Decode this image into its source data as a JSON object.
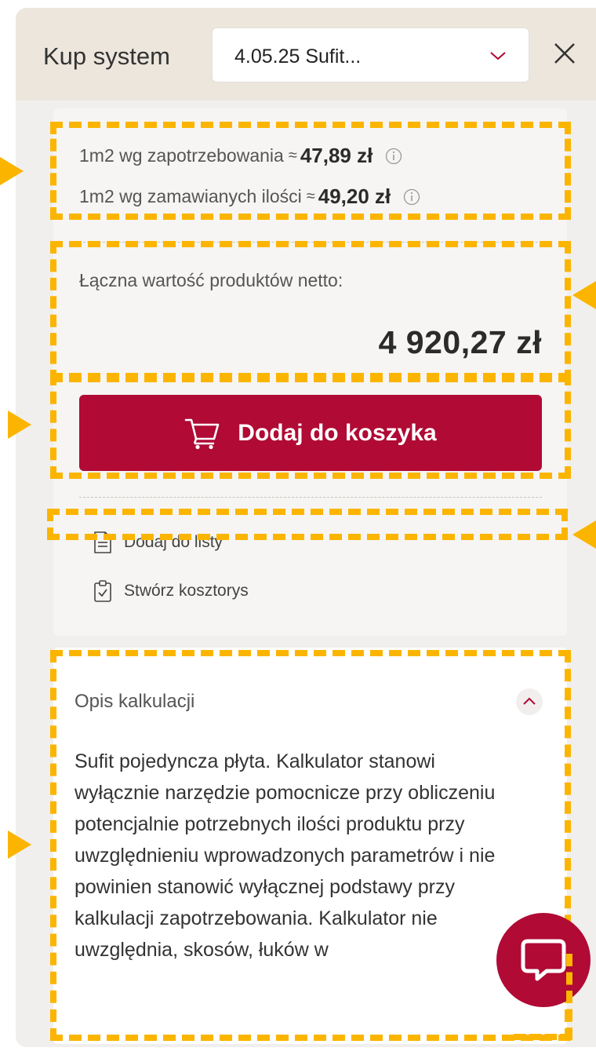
{
  "header": {
    "title": "Kup system",
    "select_value": "4.05.25 Sufit...",
    "close_icon": "close-icon",
    "chevron_icon": "chevron-down-icon"
  },
  "pricing": {
    "per_m2_need_label": "1m2 wg zapotrzebowania",
    "per_m2_need_approx": "≈",
    "per_m2_need_value": "47,89 zł",
    "per_m2_order_label": "1m2 wg zamawianych ilości",
    "per_m2_order_approx": "≈",
    "per_m2_order_value": "49,20 zł",
    "info_icon": "info-icon"
  },
  "total": {
    "label": "Łączna wartość produktów netto:",
    "value": "4 920,27 zł"
  },
  "actions": {
    "add_to_cart": "Dodaj do koszyka",
    "add_to_list": "Dodaj do listy",
    "create_estimate": "Stwórz kosztorys"
  },
  "description": {
    "title": "Opis kalkulacji",
    "text": "Sufit pojedyncza płyta. Kalkulator stanowi wyłącznie narzędzie pomocnicze przy obliczeniu potencjalnie potrzebnych ilości produktu przy uwzględnieniu wprowadzonych parametrów i nie powinien stanowić wyłącznej podstawy przy kalkulacji zapotrzebowania. Kalkulator nie uwzględnia, skosów, łuków w"
  },
  "colors": {
    "brand": "#b00a35",
    "highlight": "#fbb500",
    "header_bg": "#ece6dc",
    "panel_bg": "#f0efed"
  }
}
